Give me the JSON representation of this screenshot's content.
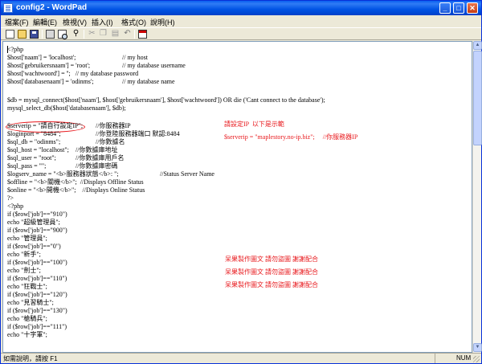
{
  "window": {
    "title": "config2 - WordPad"
  },
  "title_buttons": {
    "minimize": "_",
    "maximize": "□",
    "close": "✕"
  },
  "menu": [
    "檔案(F)",
    "編輯(E)",
    "檢視(V)",
    "插入(I)",
    "格式(O)",
    "說明(H)"
  ],
  "toolbar": [
    "new-icon",
    "open-icon",
    "save-icon",
    "print-icon",
    "print-preview-icon",
    "find-icon",
    "cut-icon",
    "copy-icon",
    "paste-icon",
    "undo-icon",
    "date-time-icon"
  ],
  "document": {
    "lines": [
      {
        "a": "<?php",
        "b": ""
      },
      {
        "a": "$host['naam'] = 'localhost';",
        "b": "// my host"
      },
      {
        "a": "$host['gebruikersnaam'] = 'root';",
        "b": "// my database username"
      },
      {
        "a": "$host['wachtwoord'] = '';   // my database password",
        "b": ""
      },
      {
        "a": "$host['databasenaam'] = 'odinms';",
        "b": "// my database name"
      },
      {
        "a": "",
        "b": ""
      },
      {
        "a": "$db = mysql_connect($host['naam'], $host['gebruikersnaam'], $host['wachtwoord']) OR die ('Cant connect to the database');",
        "b": ""
      },
      {
        "a": "mysql_select_db($host['databasenaam'], $db);",
        "b": ""
      },
      {
        "a": "",
        "b": ""
      },
      {
        "a": "$serverip = \"請自行設定IP\";",
        "b": "//你服務器IP"
      },
      {
        "a": "$loginport = \"8484\";",
        "b": "//你登陸服務器端口 默認:8484"
      },
      {
        "a": "$sql_db = \"odinms\";",
        "b": "//你數據名"
      },
      {
        "a": "$sql_host = \"localhost\";",
        "b": "//你數據庫地址"
      },
      {
        "a": "$sql_user = \"root\";",
        "b": "//你數據庫用戶名"
      },
      {
        "a": "$sql_pass = \"\";",
        "b": "//你數據庫密碼"
      },
      {
        "a": "$logserv_name = \"<b>服務器狀態</b>: \";",
        "b": "//Status Server Name"
      },
      {
        "a": "$offline = \"<b>關機</b>\";  //Displays Offline Status",
        "b": ""
      },
      {
        "a": "$online = \"<b>開機</b>\";    //Displays Online Status",
        "b": ""
      },
      {
        "a": "?>",
        "b": ""
      },
      {
        "a": "<?php",
        "b": ""
      },
      {
        "a": "if ($row['job']==\"910\")",
        "b": ""
      },
      {
        "a": "echo \"超級管理員\";",
        "b": ""
      },
      {
        "a": "if ($row['job']==\"900\")",
        "b": ""
      },
      {
        "a": "echo \"管理員\";",
        "b": ""
      },
      {
        "a": "if ($row['job']==\"0\")",
        "b": ""
      },
      {
        "a": "echo \"新手\";",
        "b": ""
      },
      {
        "a": "if ($row['job']==\"100\")",
        "b": ""
      },
      {
        "a": "echo \"劍士\";",
        "b": ""
      },
      {
        "a": "if ($row['job']==\"110\")",
        "b": ""
      },
      {
        "a": "echo \"狂戰士\";",
        "b": ""
      },
      {
        "a": "if ($row['job']==\"120\")",
        "b": ""
      },
      {
        "a": "echo \"見習騎士\";",
        "b": ""
      },
      {
        "a": "if ($row['job']==\"130\")",
        "b": ""
      },
      {
        "a": "echo \"槍騎兵\";",
        "b": ""
      },
      {
        "a": "if ($row['job']==\"111\")",
        "b": ""
      },
      {
        "a": "echo \"十字軍\";",
        "b": ""
      }
    ],
    "annotations": {
      "note_title": "請設定IP  以下是示範",
      "note_example": "$serverip = \"maplestory.no-ip.biz\";     //你服務器IP",
      "credit_1": "呆果製作圖文 請勿盜圖 謝謝配合",
      "credit_2": "呆果製作圖文 請勿盜圖 謝謝配合",
      "credit_3": "呆果製作圖文 請勿盜圖 謝謝配合"
    }
  },
  "scrollbar": {
    "up": "▲",
    "down": "▼"
  },
  "status": {
    "help_text": "如需說明，請按 F1",
    "num": "NUM"
  },
  "colors": {
    "titlebar": "#0053e4",
    "annotation_red": "#e8181c",
    "window_face": "#ece9d8"
  }
}
